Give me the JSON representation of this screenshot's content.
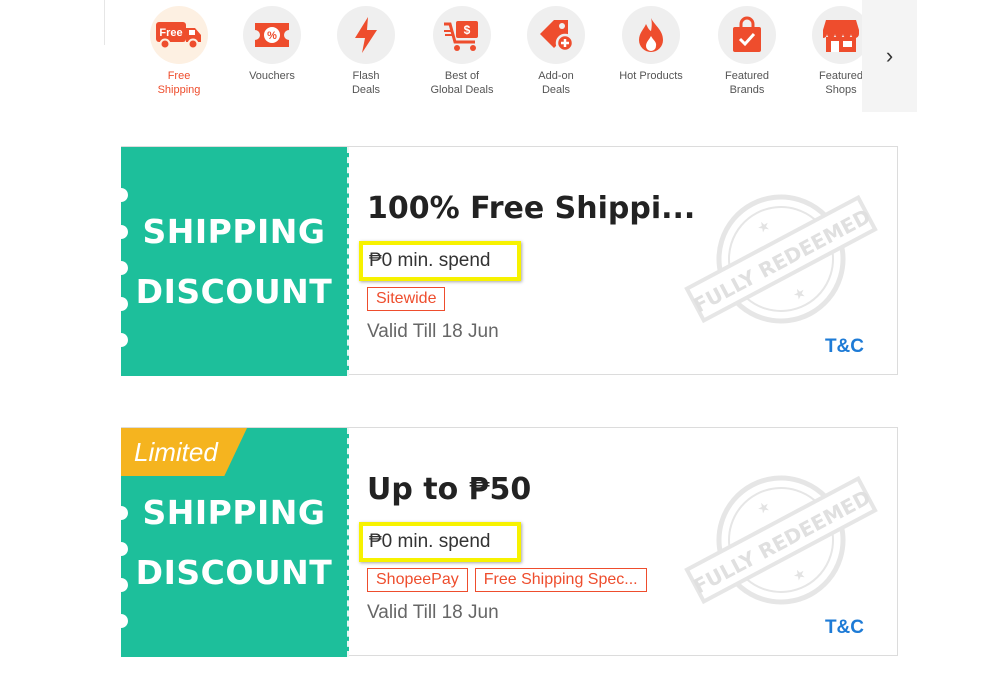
{
  "categories": [
    {
      "label": "Free\nShipping",
      "icon": "free-shipping-truck-icon",
      "active": true
    },
    {
      "label": "Vouchers",
      "icon": "voucher-percent-icon",
      "active": false
    },
    {
      "label": "Flash\nDeals",
      "icon": "flash-bolt-icon",
      "active": false
    },
    {
      "label": "Best of\nGlobal Deals",
      "icon": "global-deals-cart-icon",
      "active": false
    },
    {
      "label": "Add-on\nDeals",
      "icon": "add-on-tag-icon",
      "active": false
    },
    {
      "label": "Hot Products",
      "icon": "hot-flame-icon",
      "active": false
    },
    {
      "label": "Featured\nBrands",
      "icon": "featured-brands-bag-icon",
      "active": false
    },
    {
      "label": "Featured\nShops",
      "icon": "featured-shops-store-icon",
      "active": false
    }
  ],
  "nav": {
    "next_label": "›"
  },
  "vouchers": [
    {
      "ribbon": "",
      "left_line1": "SHIPPING",
      "left_line2": "DISCOUNT",
      "title": "100% Free Shippi...",
      "min_spend": "₱0 min. spend",
      "tags": [
        "Sitewide"
      ],
      "valid": "Valid Till 18 Jun",
      "tc": "T&C",
      "stamp": "FULLY REDEEMED"
    },
    {
      "ribbon": "Limited",
      "left_line1": "SHIPPING",
      "left_line2": "DISCOUNT",
      "title": "Up to ₱50",
      "min_spend": "₱0 min. spend",
      "tags": [
        "ShopeePay",
        "Free Shipping Spec..."
      ],
      "valid": "Valid Till 18 Jun",
      "tc": "T&C",
      "stamp": "FULLY REDEEMED"
    }
  ],
  "colors": {
    "brand_orange": "#ee4d2d",
    "voucher_teal": "#1dbf9b",
    "ribbon_yellow": "#f5b41f",
    "highlight_yellow": "#f7f200",
    "link_blue": "#1e7bd6"
  }
}
